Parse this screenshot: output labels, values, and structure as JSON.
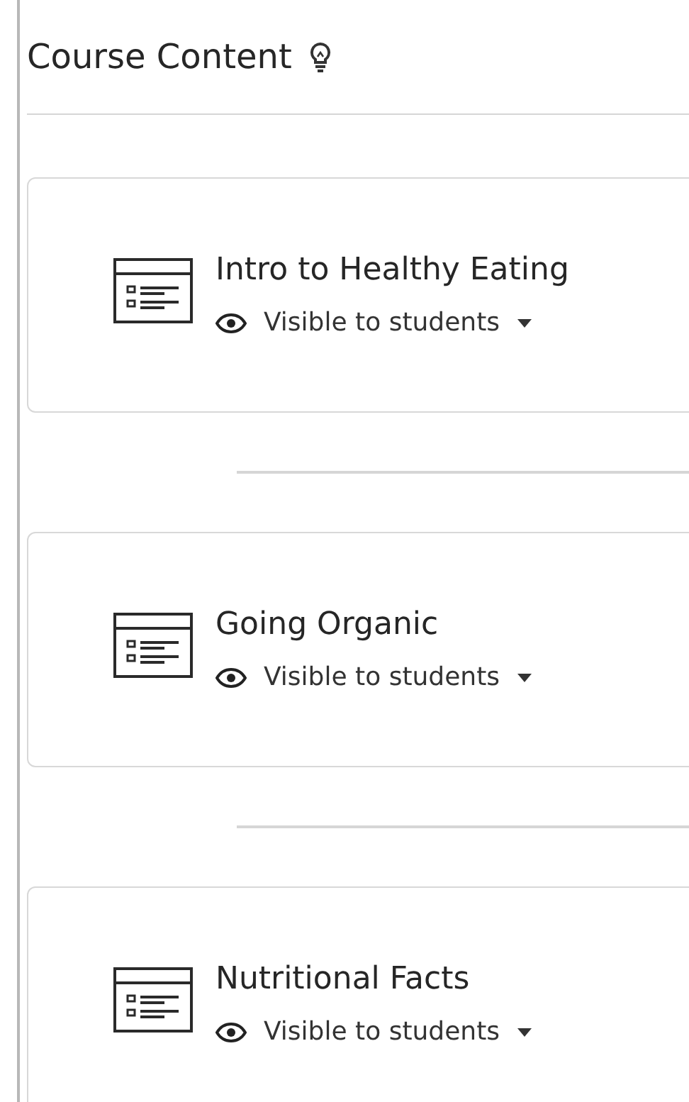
{
  "header": {
    "title": "Course Content"
  },
  "items": [
    {
      "title": "Intro to Healthy Eating",
      "visibility": "Visible to students"
    },
    {
      "title": "Going Organic",
      "visibility": "Visible to students"
    },
    {
      "title": "Nutritional Facts",
      "visibility": "Visible to students"
    }
  ]
}
